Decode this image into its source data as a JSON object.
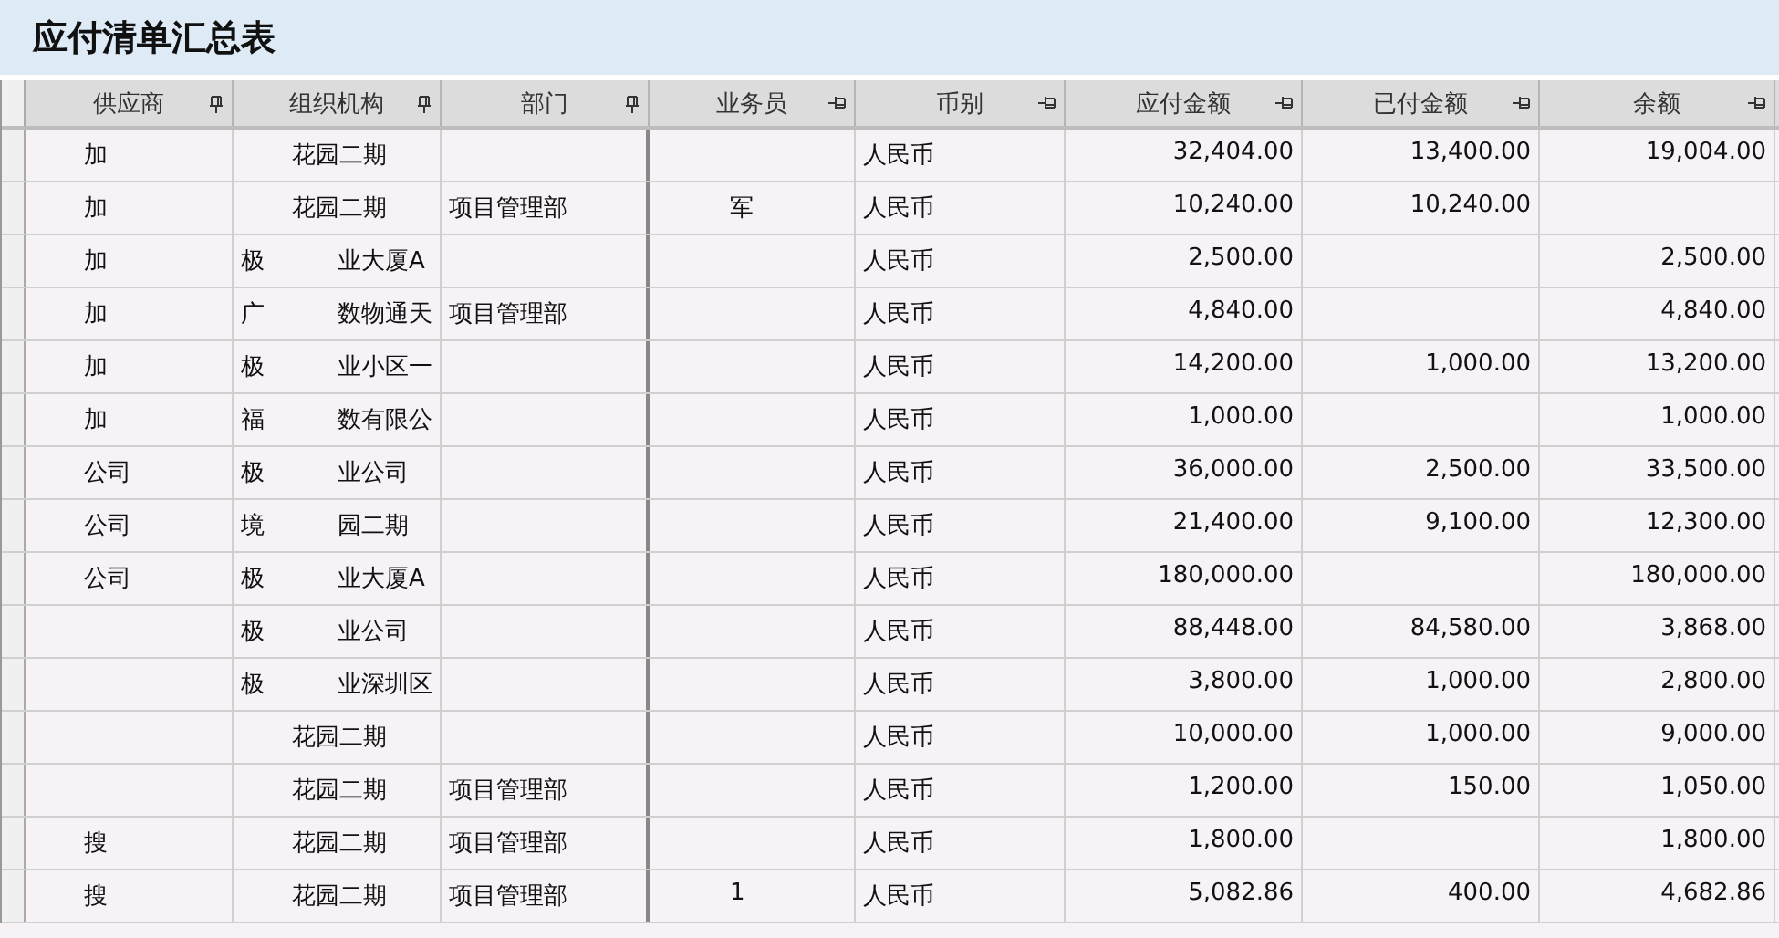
{
  "title": "应付清单汇总表",
  "table": {
    "columns": [
      {
        "label": "供应商",
        "pinned": true
      },
      {
        "label": "组织机构",
        "pinned": true
      },
      {
        "label": "部门",
        "pinned": true
      },
      {
        "label": "业务员",
        "pinned": false
      },
      {
        "label": "币别",
        "pinned": false
      },
      {
        "label": "应付金额",
        "pinned": false
      },
      {
        "label": "已付金额",
        "pinned": false
      },
      {
        "label": "余额",
        "pinned": false
      }
    ],
    "rows": [
      {
        "supplier": "加",
        "org": [
          "花园二期"
        ],
        "currency": "人民币",
        "payable": "32,404.00",
        "paid": "13,400.00",
        "balance": "19,004.00"
      },
      {
        "supplier": "加",
        "org": [
          "花园二期"
        ],
        "department": "项目管理部",
        "salesperson": "军",
        "currency": "人民币",
        "payable": "10,240.00",
        "paid": "10,240.00"
      },
      {
        "supplier": "加",
        "org": [
          "极",
          "业大厦A"
        ],
        "currency": "人民币",
        "payable": "2,500.00",
        "balance": "2,500.00"
      },
      {
        "supplier": "加",
        "org": [
          "广",
          "数物通天"
        ],
        "department": "项目管理部",
        "currency": "人民币",
        "payable": "4,840.00",
        "balance": "4,840.00"
      },
      {
        "supplier": "加",
        "org": [
          "极",
          "业小区一"
        ],
        "currency": "人民币",
        "payable": "14,200.00",
        "paid": "1,000.00",
        "balance": "13,200.00"
      },
      {
        "supplier": "加",
        "org": [
          "福",
          "数有限公"
        ],
        "currency": "人民币",
        "payable": "1,000.00",
        "balance": "1,000.00"
      },
      {
        "supplier": "公司",
        "org": [
          "极",
          "业公司"
        ],
        "currency": "人民币",
        "payable": "36,000.00",
        "paid": "2,500.00",
        "balance": "33,500.00"
      },
      {
        "supplier": "公司",
        "org": [
          "境",
          "园二期"
        ],
        "currency": "人民币",
        "payable": "21,400.00",
        "paid": "9,100.00",
        "balance": "12,300.00"
      },
      {
        "supplier": "公司",
        "org": [
          "极",
          "业大厦A"
        ],
        "currency": "人民币",
        "payable": "180,000.00",
        "balance": "180,000.00"
      },
      {
        "org": [
          "极",
          "业公司"
        ],
        "currency": "人民币",
        "payable": "88,448.00",
        "paid": "84,580.00",
        "balance": "3,868.00"
      },
      {
        "org": [
          "极",
          "业深圳区"
        ],
        "currency": "人民币",
        "payable": "3,800.00",
        "paid": "1,000.00",
        "balance": "2,800.00"
      },
      {
        "org": [
          "花园二期"
        ],
        "currency": "人民币",
        "payable": "10,000.00",
        "paid": "1,000.00",
        "balance": "9,000.00"
      },
      {
        "org": [
          "花园二期"
        ],
        "department": "项目管理部",
        "currency": "人民币",
        "payable": "1,200.00",
        "paid": "150.00",
        "balance": "1,050.00"
      },
      {
        "supplier": "搜",
        "org": [
          "花园二期"
        ],
        "department": "项目管理部",
        "currency": "人民币",
        "payable": "1,800.00",
        "balance": "1,800.00"
      },
      {
        "supplier": "搜",
        "org": [
          "花园二期"
        ],
        "department": "项目管理部",
        "salesperson": "1",
        "currency": "人民币",
        "payable": "5,082.86",
        "paid": "400.00",
        "balance": "4,682.86"
      }
    ]
  }
}
